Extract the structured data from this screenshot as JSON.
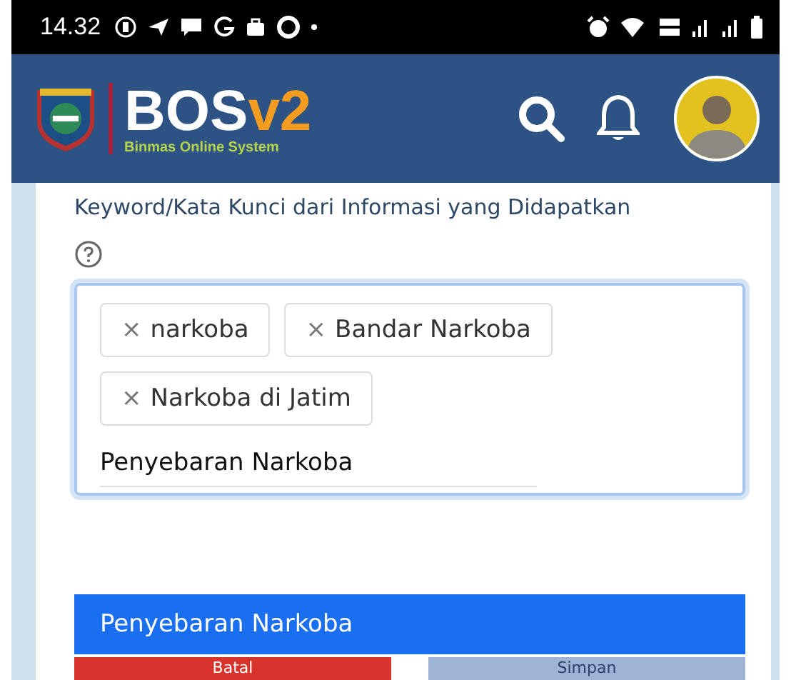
{
  "status_bar": {
    "time": "14.32"
  },
  "header": {
    "app_name": "BOS",
    "app_version": "v2",
    "tagline": "Binmas Online System"
  },
  "form": {
    "label": "Keyword/Kata Kunci dari Informasi yang Didapatkan",
    "tags": [
      {
        "label": "narkoba",
        "remove": "×"
      },
      {
        "label": "Bandar Narkoba",
        "remove": "×"
      },
      {
        "label": "Narkoba di Jatim",
        "remove": "×"
      }
    ],
    "input_value": "Penyebaran Narkoba",
    "suggestions": [
      {
        "label": "Penyebaran Narkoba",
        "selected": true
      }
    ],
    "buttons": [
      {
        "label": "Batal",
        "kind": "cancel"
      },
      {
        "label": "Simpan",
        "kind": "save"
      }
    ]
  }
}
